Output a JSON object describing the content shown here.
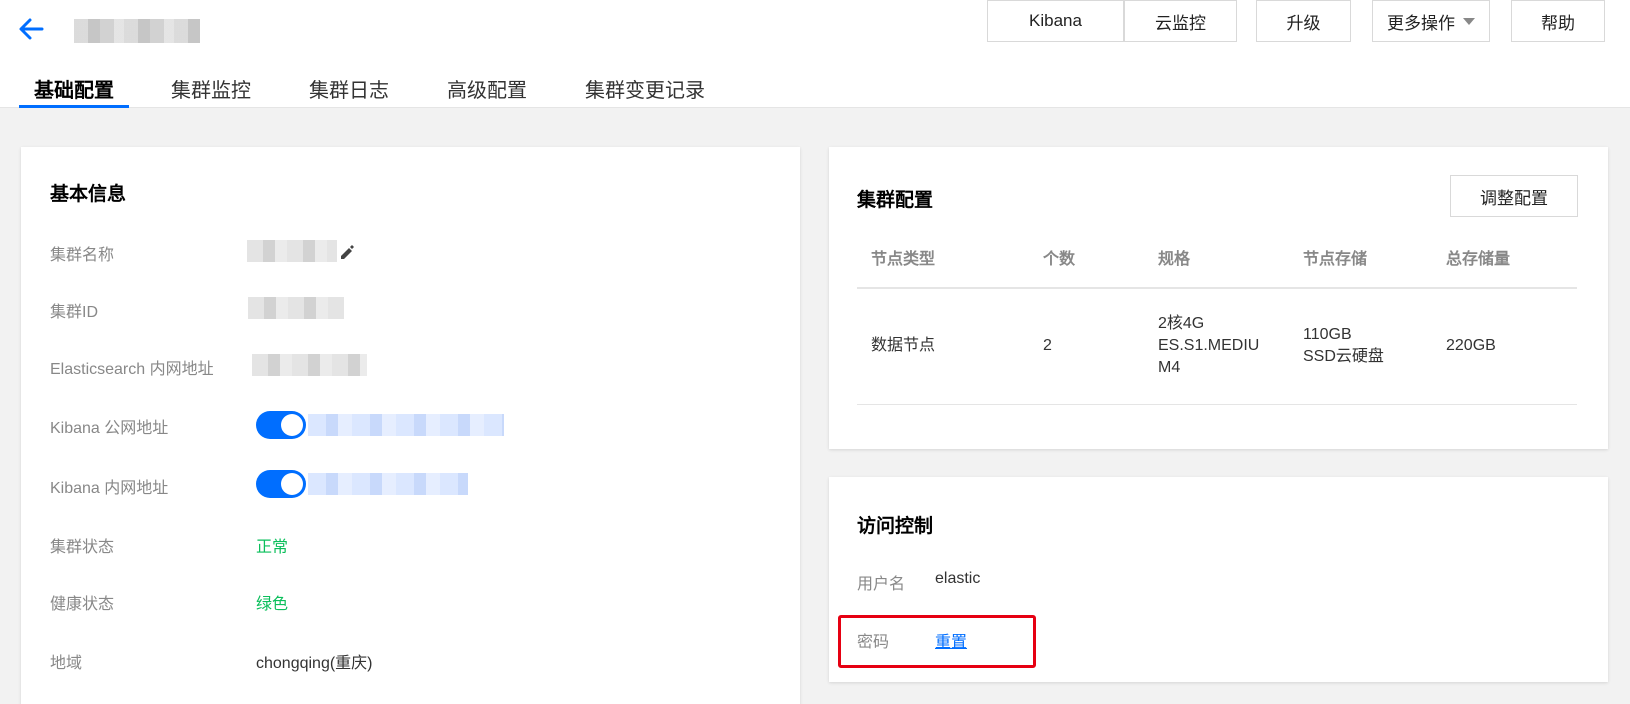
{
  "header": {
    "back_icon": "arrow-left-icon",
    "actions": {
      "kibana": "Kibana",
      "cloud_monitor": "云监控",
      "upgrade": "升级",
      "more": "更多操作",
      "help": "帮助"
    }
  },
  "tabs": [
    "基础配置",
    "集群监控",
    "集群日志",
    "高级配置",
    "集群变更记录"
  ],
  "basic_info": {
    "title": "基本信息",
    "cluster_name_label": "集群名称",
    "cluster_id_label": "集群ID",
    "es_private_label": "Elasticsearch 内网地址",
    "kibana_public_label": "Kibana 公网地址",
    "kibana_private_label": "Kibana 内网地址",
    "cluster_status_label": "集群状态",
    "cluster_status": "正常",
    "health_label": "健康状态",
    "health": "绿色",
    "region_label": "地域",
    "region": "chongqing(重庆)"
  },
  "cluster_config": {
    "title": "集群配置",
    "adjust_button": "调整配置",
    "columns": [
      "节点类型",
      "个数",
      "规格",
      "节点存储",
      "总存储量"
    ],
    "row": {
      "node_type": "数据节点",
      "count": "2",
      "spec_line1": "2核4G",
      "spec_line2": "ES.S1.MEDIU",
      "spec_line3": "M4",
      "storage_line1": "110GB",
      "storage_line2": "SSD云硬盘",
      "total": "220GB"
    }
  },
  "access_control": {
    "title": "访问控制",
    "username_label": "用户名",
    "username": "elastic",
    "password_label": "密码",
    "reset_link": "重置"
  },
  "colors": {
    "primary": "#006eff",
    "success": "#0abf5b",
    "highlight_box": "#e60012"
  }
}
